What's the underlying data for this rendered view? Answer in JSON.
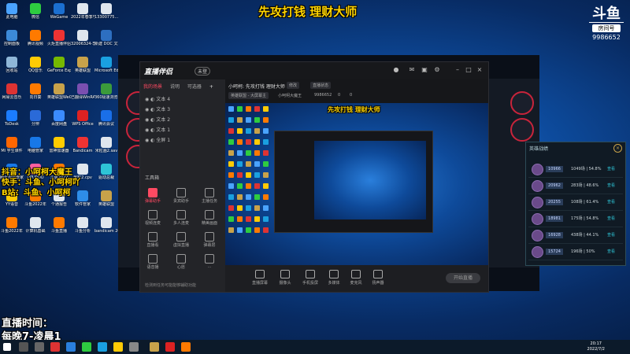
{
  "stream_overlay": {
    "banner": "先攻打钱 理财大师",
    "platforms_line1": "抖音：小呵柯大魔王",
    "platforms_line2": "快手：斗鱼、小呵柯吖",
    "platforms_line3": "B站：斗鱼、小呵柯",
    "schedule_line1": "直播时间：",
    "schedule_line2": "每晚7-凌晨1",
    "room_logo": "斗鱼",
    "room_label": "房间号",
    "room_number": "9986652"
  },
  "desktop": {
    "icons": [
      {
        "label": "此电脑",
        "color": "#4aa3ff"
      },
      {
        "label": "微信",
        "color": "#2ecc40"
      },
      {
        "label": "WeGame",
        "color": "#1b6fd0"
      },
      {
        "label": "2022年春季学期",
        "color": "#dfe6ee"
      },
      {
        "label": "13300775...",
        "color": "#dfe6ee"
      },
      {
        "label": "控制面板",
        "color": "#3c8ad8"
      },
      {
        "label": "腾讯视频",
        "color": "#ff7a00"
      },
      {
        "label": "火炬直播伴侣",
        "color": "#e33"
      },
      {
        "label": "32006324-李鸿主",
        "color": "#dfe6ee"
      },
      {
        "label": "新建 DOC 文档",
        "color": "#2d6fc1"
      },
      {
        "label": "回收站",
        "color": "#8fb7d8"
      },
      {
        "label": "QQ音乐",
        "color": "#ffcb05"
      },
      {
        "label": "GeForce Experience",
        "color": "#76b900"
      },
      {
        "label": "英雄联盟",
        "color": "#c8a24a"
      },
      {
        "label": "Microsoft Edge",
        "color": "#1aa0e0"
      },
      {
        "label": "网易云音乐",
        "color": "#d33"
      },
      {
        "label": "向日葵",
        "color": "#ff7a00"
      },
      {
        "label": "英雄联盟WeGame版",
        "color": "#c8a24a"
      },
      {
        "label": "已翻译WinRAR",
        "color": "#7a4fb0"
      },
      {
        "label": "360极速浏览器",
        "color": "#3b9b3b"
      },
      {
        "label": "ToDesk",
        "color": "#1b7cff"
      },
      {
        "label": "分辨",
        "color": "#2a6ad8"
      },
      {
        "label": "百度网盘",
        "color": "#3b8bff"
      },
      {
        "label": "WPS Office",
        "color": "#d22"
      },
      {
        "label": "腾讯会议",
        "color": "#1a6fe8"
      },
      {
        "label": "Mi 学生课件",
        "color": "#ff6600"
      },
      {
        "label": "电脑管家",
        "color": "#1878e8"
      },
      {
        "label": "雷神加速器",
        "color": "#ffcc00"
      },
      {
        "label": "Bandicam",
        "color": "#e33"
      },
      {
        "label": "米粒画2.sav",
        "color": "#dfe6ee"
      },
      {
        "label": "腾讯游戏管家",
        "color": "#1878e8"
      },
      {
        "label": "UPUPOO",
        "color": "#ff5fa0"
      },
      {
        "label": "斗鱼2022",
        "color": "#ff7a00"
      },
      {
        "label": "米粒2.cpv",
        "color": "#dfe6ee"
      },
      {
        "label": "驱动总裁",
        "color": "#2ec4d6"
      },
      {
        "label": "YY语音",
        "color": "#ffcb05"
      },
      {
        "label": "斗鱼2022年",
        "color": "#ff7a00"
      },
      {
        "label": "个通报告",
        "color": "#dfe6ee"
      },
      {
        "label": "软件管家",
        "color": "#2e8de8"
      },
      {
        "label": "英雄联盟",
        "color": "#c8a24a"
      },
      {
        "label": "斗鱼2022年",
        "color": "#ff7a00"
      },
      {
        "label": "计算机基础",
        "color": "#dfe6ee"
      },
      {
        "label": "斗鱼直播",
        "color": "#ff7a00"
      },
      {
        "label": "斗鱼分析",
        "color": "#dfe6ee"
      },
      {
        "label": "bandicam 2022-06-2...",
        "color": "#dfe6ee"
      }
    ]
  },
  "app": {
    "name": "直播伴侣",
    "badge": "未登",
    "tabs": [
      "我的场景",
      "说明",
      "可选器"
    ],
    "scenes": [
      "文本 4",
      "文本 3",
      "文本 2",
      "文本 1",
      "全屏 1"
    ],
    "tools_title": "工具箱",
    "tools": [
      "弹幕助手",
      "贵宾助手",
      "主播任务",
      "视频连麦",
      "多人连麦",
      "精美画面",
      "直播看",
      "虚拟直播",
      "弹幕层",
      "语音播",
      "心愿",
      "…"
    ],
    "footer_text": "检测到任务可能能够辅助功能",
    "preview_title": "小呵柯: 先攻打钱 理财大师",
    "edit_label": "修改",
    "stream_status": "直播状态",
    "category": "英雄联盟 - 大屏幕主",
    "streamer": "小呵柯大魔王",
    "room_no": "9986652",
    "likes": "0",
    "fans": "0",
    "bottom_buttons": [
      "直播屏幕",
      "摄像头",
      "手机投屏",
      "多媒体",
      "麦克风",
      "扬声器"
    ],
    "start_live": "开始直播"
  },
  "hero_panel": {
    "title": "英雄战绩",
    "close": "×",
    "rows": [
      {
        "score": "10966",
        "stats": "1049场 | 54.8%",
        "action": "查看"
      },
      {
        "score": "20962",
        "stats": "283场 | 48.6%",
        "action": "查看"
      },
      {
        "score": "20255",
        "stats": "108场 | 61.4%",
        "action": "查看"
      },
      {
        "score": "18981",
        "stats": "175场 | 54.8%",
        "action": "查看"
      },
      {
        "score": "16928",
        "stats": "438场 | 44.1%",
        "action": "查看"
      },
      {
        "score": "15724",
        "stats": "196场 | 50%",
        "action": "查看"
      }
    ]
  },
  "taskbar": {
    "time": "20:17",
    "date": "2022/7/2"
  }
}
